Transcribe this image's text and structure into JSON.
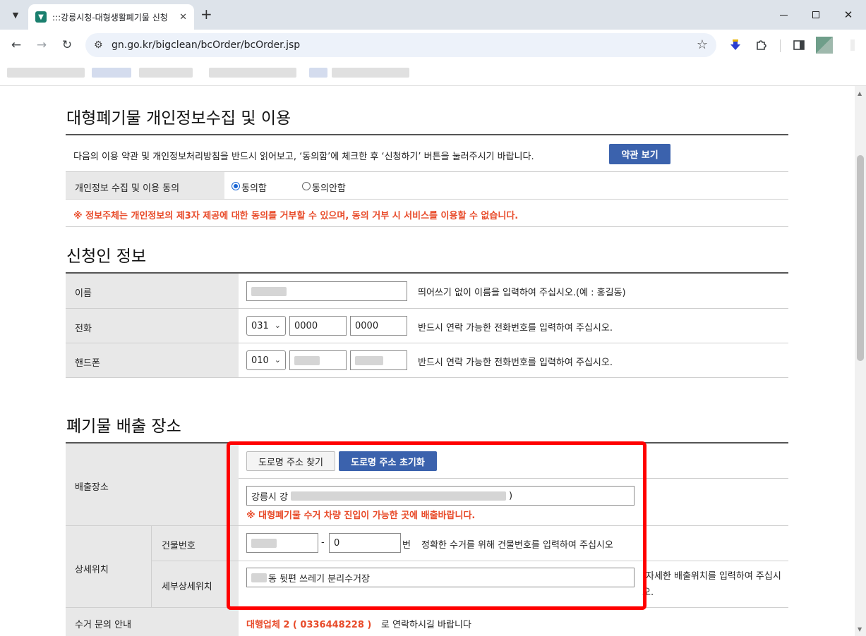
{
  "browser": {
    "tab_title": ":::강릉시청-대형생활폐기물 신청",
    "tab_close": "✕",
    "new_tab": "+",
    "url": "gn.go.kr/bigclean/bcOrder/bcOrder.jsp"
  },
  "consent": {
    "title": "대형폐기물 개인정보수집 및 이용",
    "notice": "다음의 이용 약관 및 개인정보처리방침을 반드시 읽어보고, ‘동의함’에 체크한 후 ‘신청하기’ 버튼을 눌러주시기 바랍니다.",
    "terms_button": "약관 보기",
    "row_label": "개인정보 수집 및 이용 동의",
    "agree_label": "동의함",
    "disagree_label": "동의안함",
    "selected": "agree",
    "warning": "※ 정보주체는 개인정보의 제3자 제공에 대한 동의를 거부할 수 있으며, 동의 거부 시 서비스를 이용할 수 없습니다."
  },
  "applicant": {
    "title": "신청인 정보",
    "name_label": "이름",
    "name_hint": "띄어쓰기 없이 이름을 입력하여 주십시오.(예 : 홍길동)",
    "phone_label": "전화",
    "phone_area": "031",
    "phone_mid": "0000",
    "phone_last": "0000",
    "phone_hint": "반드시 연락 가능한 전화번호를 입력하여 주십시오.",
    "mobile_label": "핸드폰",
    "mobile_prefix": "010",
    "mobile_hint": "반드시 연락 가능한 전화번호를 입력하여 주십시오."
  },
  "location": {
    "title": "폐기물 배출 장소",
    "place_label": "배출장소",
    "find_address_button": "도로명 주소 찾기",
    "reset_address_button": "도로명 주소 초기화",
    "address_prefix": "강릉시 강",
    "address_note": "※ 대형폐기물 수거 차량 진입이 가능한 곳에 배출바랍니다.",
    "detail_label": "상세위치",
    "building_label": "건물번호",
    "building_sub": "0",
    "building_unit": "번",
    "building_hint": "정확한 수거를 위해 건물번호를 입력하여 주십시오",
    "sub_detail_label": "세부상세위치",
    "sub_detail_value": "동 뒷편 쓰레기 분리수거장",
    "sub_detail_hint": "자세한 배출위치를 입력하여 주십시오.",
    "inquiry_label": "수거 문의 안내",
    "inquiry_company": "대행업체 2 ( 0336448228 )",
    "inquiry_suffix": "로 연락하시길 바랍니다"
  }
}
